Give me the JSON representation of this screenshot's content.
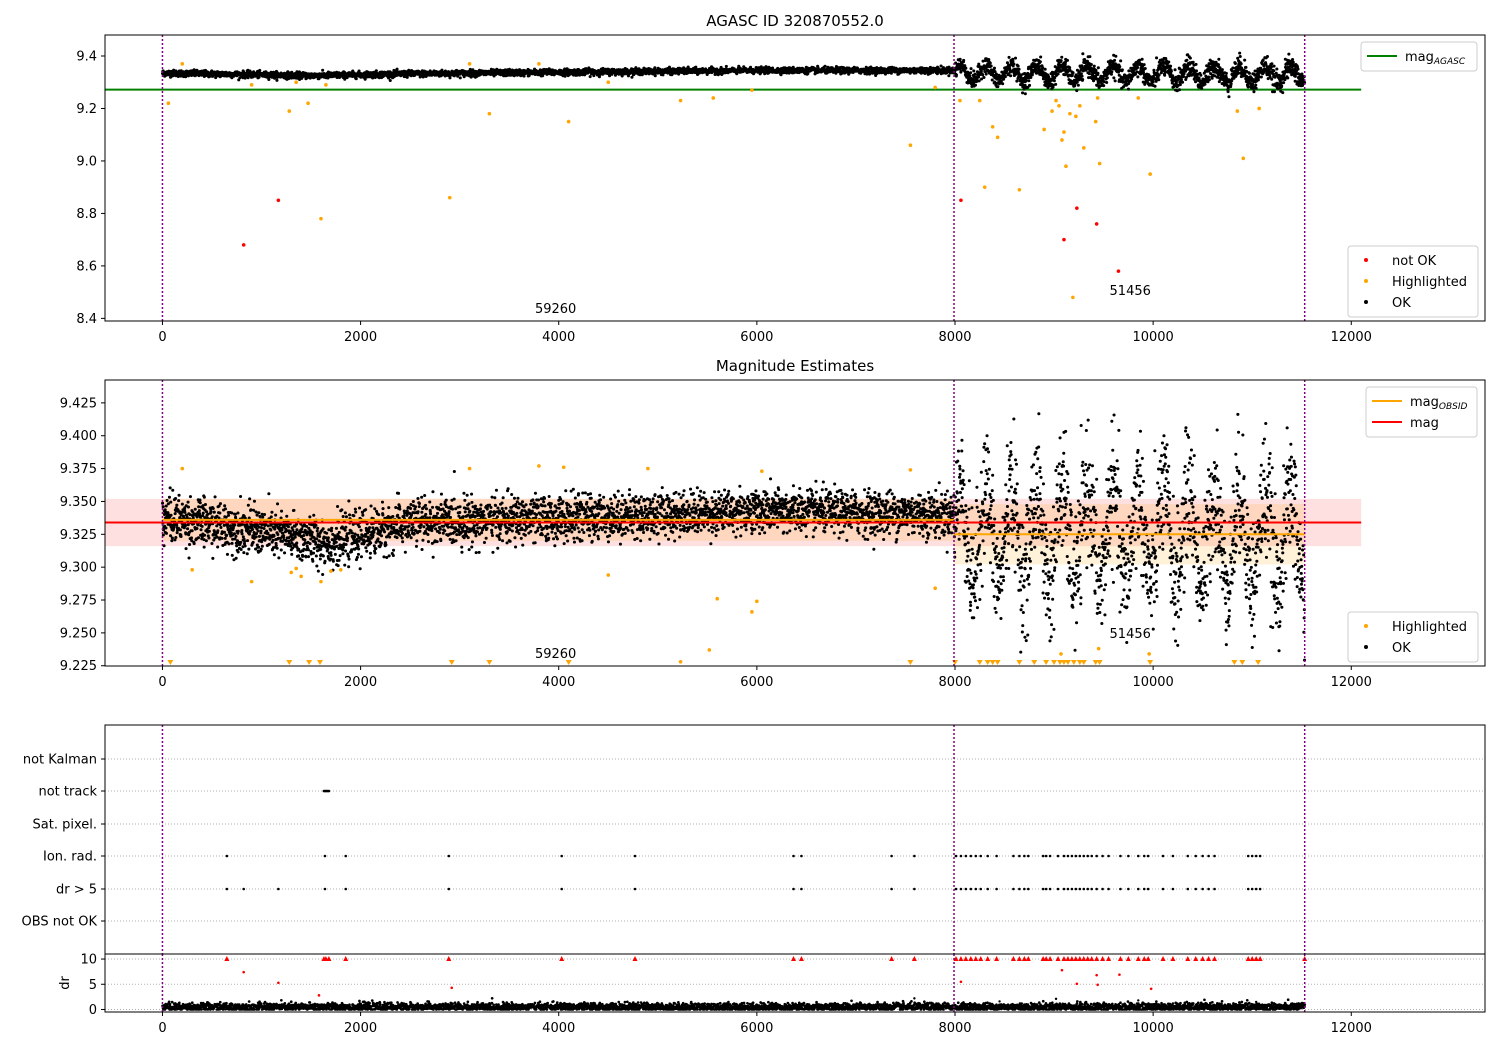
{
  "chart_data": [
    {
      "id": "top",
      "type": "scatter",
      "title": "AGASC ID 320870552.0",
      "xlim": [
        -580,
        13350
      ],
      "ylim": [
        8.39,
        9.48
      ],
      "xticks": [
        0,
        2000,
        4000,
        6000,
        8000,
        10000,
        12000
      ],
      "yticks": [
        8.4,
        8.6,
        8.8,
        9.0,
        9.2,
        9.4
      ],
      "ytick_labels": [
        "8.4",
        "8.6",
        "8.8",
        "9.0",
        "9.2",
        "9.4"
      ],
      "vlines": [
        0,
        7990,
        11530
      ],
      "hlines": [
        {
          "y": 9.272,
          "x": [
            -580,
            12100
          ],
          "color": "#008000",
          "series": "mag_AGASC"
        }
      ],
      "legend": {
        "position": "top-right",
        "entries": [
          {
            "label": "mag",
            "sub": "AGASC",
            "color": "#008000",
            "kind": "line"
          }
        ]
      },
      "legend2": {
        "position": "lower-right",
        "entries": [
          {
            "label": "not OK",
            "color": "#ff0000",
            "kind": "dot"
          },
          {
            "label": "Highlighted",
            "color": "#ffa500",
            "kind": "dot"
          },
          {
            "label": "OK",
            "color": "#000000",
            "kind": "dot"
          }
        ]
      },
      "annotations": [
        {
          "text": "59260",
          "x": 3760,
          "y": 8.42
        },
        {
          "text": "51456",
          "x": 9560,
          "y": 8.49
        }
      ],
      "ok_trend": [
        {
          "x": 0,
          "y": 9.335,
          "spread": 0.012
        },
        {
          "x": 1500,
          "y": 9.325,
          "spread": 0.012
        },
        {
          "x": 2500,
          "y": 9.332,
          "spread": 0.012
        },
        {
          "x": 4000,
          "y": 9.338,
          "spread": 0.012
        },
        {
          "x": 6000,
          "y": 9.345,
          "spread": 0.011
        },
        {
          "x": 7990,
          "y": 9.345,
          "spread": 0.012
        },
        {
          "x": 8000,
          "y": 9.335,
          "spread": 0.035
        },
        {
          "x": 11530,
          "y": 9.33,
          "spread": 0.045
        }
      ],
      "highlighted_points": [
        [
          60,
          9.22
        ],
        [
          200,
          9.37
        ],
        [
          900,
          9.29
        ],
        [
          1280,
          9.19
        ],
        [
          1350,
          9.3
        ],
        [
          1470,
          9.22
        ],
        [
          1600,
          8.78
        ],
        [
          1650,
          9.29
        ],
        [
          2900,
          8.86
        ],
        [
          3100,
          9.37
        ],
        [
          3300,
          9.18
        ],
        [
          3800,
          9.37
        ],
        [
          4100,
          9.15
        ],
        [
          4500,
          9.3
        ],
        [
          5230,
          9.23
        ],
        [
          5560,
          9.24
        ],
        [
          5950,
          9.27
        ],
        [
          7550,
          9.06
        ],
        [
          7800,
          9.28
        ],
        [
          8050,
          9.23
        ],
        [
          8250,
          9.23
        ],
        [
          8300,
          8.9
        ],
        [
          8380,
          9.13
        ],
        [
          8430,
          9.09
        ],
        [
          8650,
          8.89
        ],
        [
          8900,
          9.12
        ],
        [
          8980,
          9.19
        ],
        [
          9020,
          9.23
        ],
        [
          9050,
          9.21
        ],
        [
          9080,
          9.08
        ],
        [
          9100,
          9.11
        ],
        [
          9120,
          8.98
        ],
        [
          9160,
          9.18
        ],
        [
          9220,
          9.17
        ],
        [
          9260,
          9.21
        ],
        [
          9300,
          9.05
        ],
        [
          9420,
          9.15
        ],
        [
          9440,
          9.24
        ],
        [
          9460,
          8.99
        ],
        [
          9850,
          9.24
        ],
        [
          9970,
          8.95
        ],
        [
          10850,
          9.19
        ],
        [
          10910,
          9.01
        ],
        [
          11070,
          9.2
        ],
        [
          9190,
          8.48
        ]
      ],
      "notok_points": [
        [
          820,
          8.68
        ],
        [
          1170,
          8.85
        ],
        [
          8060,
          8.85
        ],
        [
          9100,
          8.7
        ],
        [
          9230,
          8.82
        ],
        [
          9430,
          8.76
        ],
        [
          9650,
          8.58
        ]
      ]
    },
    {
      "id": "middle",
      "type": "scatter",
      "title": "Magnitude Estimates",
      "xlim": [
        -580,
        13350
      ],
      "ylim": [
        9.2248,
        9.4424
      ],
      "xticks": [
        0,
        2000,
        4000,
        6000,
        8000,
        10000,
        12000
      ],
      "yticks": [
        9.225,
        9.25,
        9.275,
        9.3,
        9.325,
        9.35,
        9.375,
        9.4,
        9.425
      ],
      "ytick_labels": [
        "9.225",
        "9.250",
        "9.275",
        "9.300",
        "9.325",
        "9.350",
        "9.375",
        "9.400",
        "9.425"
      ],
      "vlines": [
        0,
        7990,
        11530
      ],
      "mag": {
        "value": 9.334,
        "band": [
          9.316,
          9.352
        ],
        "x": [
          -580,
          12100
        ],
        "color": "#ff0000"
      },
      "mag_obsid": [
        {
          "x": [
            0,
            7990
          ],
          "value": 9.336,
          "band": [
            9.32,
            9.352
          ]
        },
        {
          "x": [
            7990,
            11530
          ],
          "value": 9.325,
          "band": [
            9.302,
            9.348
          ]
        }
      ],
      "legend": {
        "position": "top-right",
        "entries": [
          {
            "label": "mag",
            "sub": "OBSID",
            "color": "#ffa500",
            "kind": "line"
          },
          {
            "label": "mag",
            "sub": "",
            "color": "#ff0000",
            "kind": "line"
          }
        ]
      },
      "legend2": {
        "position": "lower-right",
        "entries": [
          {
            "label": "Highlighted",
            "color": "#ffa500",
            "kind": "dot"
          },
          {
            "label": "OK",
            "color": "#000000",
            "kind": "dot"
          }
        ]
      },
      "annotations": [
        {
          "text": "59260",
          "x": 3760,
          "y": 9.231
        },
        {
          "text": "51456",
          "x": 9560,
          "y": 9.246
        }
      ],
      "ok_trend": [
        {
          "x": 0,
          "y": 9.338,
          "spread": 0.018
        },
        {
          "x": 1000,
          "y": 9.327,
          "spread": 0.018
        },
        {
          "x": 1700,
          "y": 9.318,
          "spread": 0.018
        },
        {
          "x": 2500,
          "y": 9.334,
          "spread": 0.018
        },
        {
          "x": 4000,
          "y": 9.337,
          "spread": 0.017
        },
        {
          "x": 6000,
          "y": 9.343,
          "spread": 0.016
        },
        {
          "x": 7990,
          "y": 9.34,
          "spread": 0.017
        },
        {
          "x": 8000,
          "y": 9.325,
          "spread": 0.05
        },
        {
          "x": 11530,
          "y": 9.322,
          "spread": 0.055
        }
      ],
      "highlighted_points": [
        [
          200,
          9.375
        ],
        [
          300,
          9.298
        ],
        [
          900,
          9.289
        ],
        [
          1300,
          9.296
        ],
        [
          1350,
          9.299
        ],
        [
          1400,
          9.293
        ],
        [
          1600,
          9.289
        ],
        [
          1700,
          9.297
        ],
        [
          1800,
          9.298
        ],
        [
          3100,
          9.375
        ],
        [
          3800,
          9.377
        ],
        [
          4050,
          9.376
        ],
        [
          4500,
          9.294
        ],
        [
          5600,
          9.276
        ],
        [
          5950,
          9.266
        ],
        [
          6000,
          9.274
        ],
        [
          5230,
          9.228
        ],
        [
          5520,
          9.237
        ],
        [
          7550,
          9.374
        ],
        [
          7800,
          9.284
        ],
        [
          9070,
          9.234
        ],
        [
          9450,
          9.238
        ],
        [
          9960,
          9.234
        ],
        [
          4900,
          9.375
        ],
        [
          6050,
          9.373
        ]
      ],
      "triangles_x": [
        80,
        1280,
        1480,
        1590,
        2920,
        3300,
        4100,
        7550,
        8000,
        8250,
        8330,
        8380,
        8430,
        8650,
        8800,
        8920,
        9000,
        9060,
        9100,
        9140,
        9200,
        9260,
        9300,
        9420,
        9460,
        9970,
        10820,
        10900,
        11060
      ]
    },
    {
      "id": "flags",
      "type": "scatter",
      "xlim": [
        -580,
        13350
      ],
      "xticks": [
        0,
        2000,
        4000,
        6000,
        8000,
        10000,
        12000
      ],
      "vlines": [
        0,
        7990,
        11530
      ],
      "flag_labels": [
        "not Kalman",
        "not track",
        "Sat. pixel.",
        "Ion. rad.",
        "dr > 5",
        "OBS not OK"
      ],
      "flags": {
        "not track": [
          1630,
          1640,
          1650,
          1660,
          1670,
          1680
        ],
        "Ion. rad.": [
          650,
          1640,
          1850,
          2890,
          4030,
          4770,
          6370,
          6450,
          7360,
          7590,
          8010,
          8060,
          8110,
          8160,
          8210,
          8260,
          8330,
          8420,
          8590,
          8650,
          8700,
          8740,
          8890,
          8920,
          8960,
          9040,
          9100,
          9140,
          9180,
          9220,
          9260,
          9300,
          9340,
          9380,
          9430,
          9490,
          9550,
          9670,
          9750,
          9850,
          9910,
          9950,
          10100,
          10200,
          10350,
          10430,
          10500,
          10560,
          10620,
          10960,
          11000,
          11040,
          11080
        ],
        "dr > 5": [
          650,
          820,
          1170,
          1640,
          1850,
          2890,
          4030,
          4770,
          6370,
          6450,
          7360,
          7590,
          8010,
          8060,
          8110,
          8160,
          8210,
          8260,
          8330,
          8420,
          8590,
          8650,
          8700,
          8740,
          8890,
          8920,
          8960,
          9040,
          9100,
          9140,
          9180,
          9220,
          9260,
          9300,
          9340,
          9380,
          9430,
          9490,
          9550,
          9670,
          9750,
          9850,
          9910,
          9950,
          10100,
          10200,
          10350,
          10430,
          10500,
          10560,
          10620,
          10960,
          11000,
          11040,
          11080
        ]
      }
    },
    {
      "id": "dr",
      "type": "scatter",
      "ylabel": "dr",
      "xlim": [
        -580,
        13350
      ],
      "ylim": [
        -0.5,
        11.0
      ],
      "xticks": [
        0,
        2000,
        4000,
        6000,
        8000,
        10000,
        12000
      ],
      "yticks": [
        0,
        5,
        10
      ],
      "ytick_labels": [
        "0",
        "5",
        "10"
      ],
      "vlines": [
        0,
        7990,
        11530
      ],
      "clip_value": 10,
      "baseline": {
        "x": [
          0,
          11530
        ],
        "mean": 0.5,
        "spread": 0.4
      },
      "red_points": [
        [
          820,
          7.4
        ],
        [
          1170,
          5.3
        ],
        [
          1580,
          2.8
        ],
        [
          2920,
          4.3
        ],
        [
          8060,
          5.5
        ],
        [
          9080,
          7.8
        ],
        [
          9230,
          5.1
        ],
        [
          9430,
          6.8
        ],
        [
          9660,
          6.9
        ],
        [
          9440,
          4.9
        ],
        [
          9980,
          4.1
        ]
      ],
      "red_triangles_x": [
        650,
        1630,
        1650,
        1680,
        1850,
        2890,
        4030,
        4770,
        6370,
        6450,
        7360,
        7590,
        8010,
        8060,
        8110,
        8160,
        8210,
        8260,
        8330,
        8420,
        8590,
        8650,
        8700,
        8740,
        8890,
        8920,
        8960,
        9040,
        9100,
        9140,
        9180,
        9220,
        9260,
        9300,
        9340,
        9380,
        9430,
        9490,
        9550,
        9670,
        9750,
        9850,
        9910,
        9950,
        10100,
        10200,
        10350,
        10430,
        10500,
        10560,
        10620,
        10960,
        11000,
        11040,
        11080,
        11530
      ],
      "black_outliers": [
        [
          7590,
          2.2
        ],
        [
          8450,
          1.6
        ],
        [
          9020,
          2.1
        ],
        [
          9850,
          1.8
        ],
        [
          11040,
          1.5
        ]
      ]
    }
  ]
}
